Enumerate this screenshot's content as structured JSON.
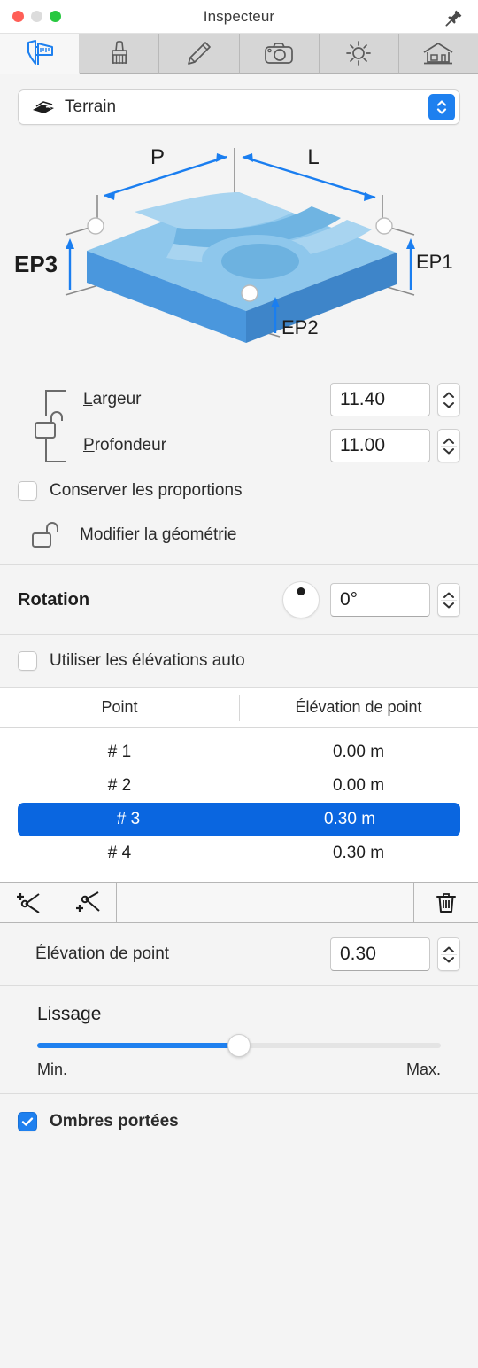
{
  "window": {
    "title": "Inspecteur",
    "pin_icon": "pushpin-icon",
    "traffic_lights": [
      "close",
      "minimize",
      "zoom"
    ]
  },
  "tabbar": {
    "tabs": [
      {
        "id": "measure",
        "icon": "caliper-icon",
        "active": true
      },
      {
        "id": "materials",
        "icon": "brush-icon",
        "active": false
      },
      {
        "id": "annotate",
        "icon": "pencil-icon",
        "active": false
      },
      {
        "id": "camera",
        "icon": "camera-icon",
        "active": false
      },
      {
        "id": "light",
        "icon": "sun-icon",
        "active": false
      },
      {
        "id": "building",
        "icon": "house-icon",
        "active": false
      }
    ]
  },
  "object_popup": {
    "label": "Terrain",
    "icon": "terrain-layers-icon",
    "stepper_icon": "updown-chevrons-icon",
    "accent": "#1e80ef"
  },
  "diagram": {
    "name": "terrain-dimension-diagram",
    "labels": {
      "depth": "P",
      "width": "L",
      "ep1": "EP1",
      "ep2": "EP2",
      "ep3": "EP3"
    },
    "highlighted_label": "EP3",
    "colors": {
      "top_light": "#8ec7ec",
      "top_mid": "#6fb4e2",
      "top_dark": "#539fd6",
      "side_left": "#4a97dd",
      "side_right": "#3e85c9",
      "arrow": "#1a7ef0",
      "guide": "#8a8a8a"
    }
  },
  "dimensions": {
    "lock_icon": "link-bracket-unlocked-icon",
    "width": {
      "label": "Largeur",
      "mnemonic": "L",
      "value": "11.40"
    },
    "depth": {
      "label": "Profondeur",
      "mnemonic": "P",
      "value": "11.00"
    },
    "keep_proportions": {
      "label": "Conserver les proportions",
      "checked": false
    },
    "edit_geometry": {
      "label": "Modifier la géométrie",
      "icon": "padlock-open-icon"
    }
  },
  "rotation": {
    "label": "Rotation",
    "value": "0°",
    "dial_angle_deg": 0
  },
  "auto_elevations": {
    "label": "Utiliser les élévations auto",
    "checked": false
  },
  "points_table": {
    "columns": [
      "Point",
      "Élévation de point"
    ],
    "rows": [
      {
        "point": "# 1",
        "elevation": "0.00 m",
        "selected": false
      },
      {
        "point": "# 2",
        "elevation": "0.00 m",
        "selected": false
      },
      {
        "point": "# 3",
        "elevation": "0.30 m",
        "selected": true
      },
      {
        "point": "# 4",
        "elevation": "0.30 m",
        "selected": false
      }
    ],
    "selection_color": "#0a66e0"
  },
  "point_toolbar": {
    "buttons": [
      {
        "id": "add-point-before",
        "icon": "add-vertex-above-icon"
      },
      {
        "id": "add-point-after",
        "icon": "add-vertex-below-icon"
      },
      {
        "id": "delete-point",
        "icon": "trash-icon"
      }
    ]
  },
  "point_elevation": {
    "label": "Élévation de point",
    "mnemonic": "É",
    "value": "0.30"
  },
  "smoothing": {
    "title": "Lissage",
    "min_label": "Min.",
    "max_label": "Max.",
    "value_percent": 50
  },
  "shadows": {
    "label": "Ombres portées",
    "checked": true
  }
}
